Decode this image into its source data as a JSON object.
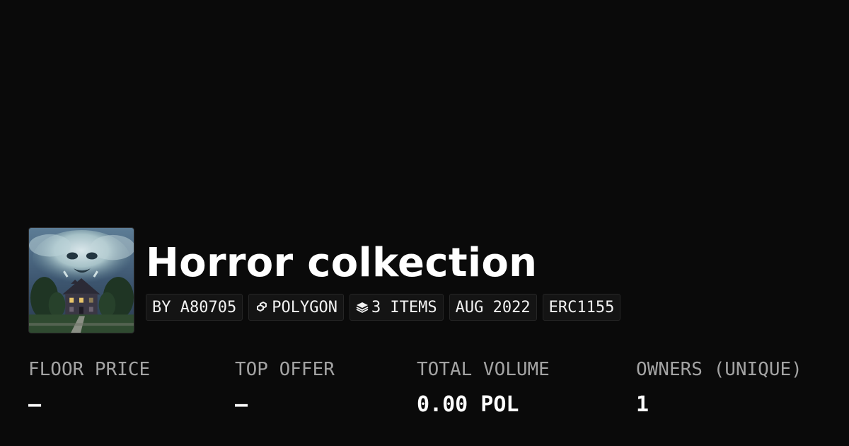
{
  "collection": {
    "name": "Horror colkection",
    "image_icon": "haunted-house-artwork",
    "tags": {
      "creator": "BY A80705",
      "chain": "POLYGON",
      "chain_icon": "polygon-link-icon",
      "items": "3 ITEMS",
      "items_icon": "layers-icon",
      "date": "AUG 2022",
      "standard": "ERC1155"
    }
  },
  "stats": {
    "floor_price": {
      "label": "FLOOR PRICE",
      "value": "—"
    },
    "top_offer": {
      "label": "TOP OFFER",
      "value": "—"
    },
    "total_volume": {
      "label": "TOTAL VOLUME",
      "value": "0.00 POL"
    },
    "owners": {
      "label": "OWNERS (UNIQUE)",
      "value": "1"
    }
  },
  "colors": {
    "background": "#0a0a0a",
    "tag_background": "#141414",
    "label": "#a3a3a3",
    "value": "#ffffff"
  }
}
